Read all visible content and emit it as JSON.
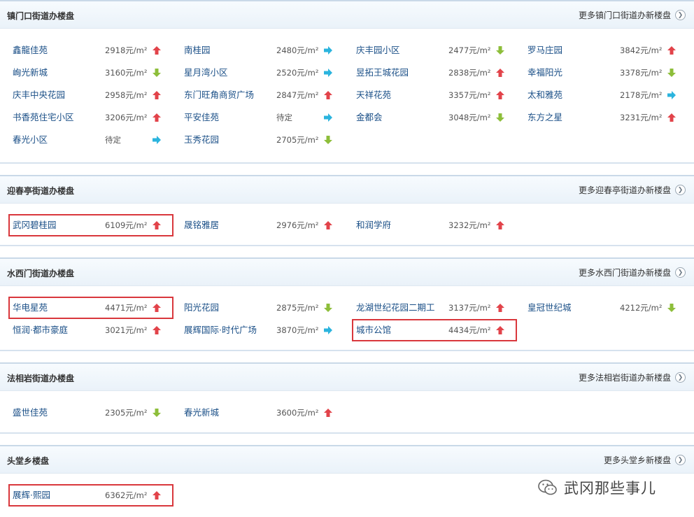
{
  "sections": [
    {
      "title": "镇门口街道办楼盘",
      "more": "更多镇门口街道办新楼盘",
      "items": [
        {
          "name": "鑫龍佳苑",
          "price": "2918元/m²",
          "trend": "up"
        },
        {
          "name": "南桂园",
          "price": "2480元/m²",
          "trend": "flat"
        },
        {
          "name": "庆丰园小区",
          "price": "2477元/m²",
          "trend": "down"
        },
        {
          "name": "罗马庄园",
          "price": "3842元/m²",
          "trend": "up"
        },
        {
          "name": "峋光新城",
          "price": "3160元/m²",
          "trend": "down"
        },
        {
          "name": "星月湾小区",
          "price": "2520元/m²",
          "trend": "flat"
        },
        {
          "name": "昱拓王城花园",
          "price": "2838元/m²",
          "trend": "up"
        },
        {
          "name": "幸福阳光",
          "price": "3378元/m²",
          "trend": "down"
        },
        {
          "name": "庆丰中央花园",
          "price": "2958元/m²",
          "trend": "up"
        },
        {
          "name": "东门旺角商贸广场",
          "price": "2847元/m²",
          "trend": "up"
        },
        {
          "name": "天祥花苑",
          "price": "3357元/m²",
          "trend": "up"
        },
        {
          "name": "太和雅苑",
          "price": "2178元/m²",
          "trend": "flat"
        },
        {
          "name": "书香苑住宅小区",
          "price": "3206元/m²",
          "trend": "up"
        },
        {
          "name": "平安佳苑",
          "price": "待定",
          "trend": "flat"
        },
        {
          "name": "金都会",
          "price": "3048元/m²",
          "trend": "down"
        },
        {
          "name": "东方之星",
          "price": "3231元/m²",
          "trend": "up"
        },
        {
          "name": "春光小区",
          "price": "待定",
          "trend": "flat"
        },
        {
          "name": "玉秀花园",
          "price": "2705元/m²",
          "trend": "down"
        }
      ]
    },
    {
      "title": "迎春亭街道办楼盘",
      "more": "更多迎春亭街道办新楼盘",
      "items": [
        {
          "name": "武冈碧桂园",
          "price": "6109元/m²",
          "trend": "up",
          "highlight": true
        },
        {
          "name": "晟铭雅居",
          "price": "2976元/m²",
          "trend": "up"
        },
        {
          "name": "和润学府",
          "price": "3232元/m²",
          "trend": "up"
        }
      ]
    },
    {
      "title": "水西门街道办楼盘",
      "more": "更多水西门街道办新楼盘",
      "items": [
        {
          "name": "华电星苑",
          "price": "4471元/m²",
          "trend": "up",
          "highlight": true
        },
        {
          "name": "阳光花园",
          "price": "2875元/m²",
          "trend": "down"
        },
        {
          "name": "龙湖世纪花园二期工",
          "price": "3137元/m²",
          "trend": "up"
        },
        {
          "name": "皇冠世纪城",
          "price": "4212元/m²",
          "trend": "down"
        },
        {
          "name": "恒润·都市豪庭",
          "price": "3021元/m²",
          "trend": "up"
        },
        {
          "name": "展辉国际·时代广场",
          "price": "3870元/m²",
          "trend": "flat"
        },
        {
          "name": "城市公馆",
          "price": "4434元/m²",
          "trend": "up",
          "highlight": true
        }
      ]
    },
    {
      "title": "法相岩街道办楼盘",
      "more": "更多法相岩街道办新楼盘",
      "items": [
        {
          "name": "盛世佳苑",
          "price": "2305元/m²",
          "trend": "down"
        },
        {
          "name": "春光新城",
          "price": "3600元/m²",
          "trend": "up"
        }
      ]
    },
    {
      "title": "头堂乡楼盘",
      "more": "更多头堂乡新楼盘",
      "items": [
        {
          "name": "展辉·熙园",
          "price": "6362元/m²",
          "trend": "up",
          "highlight": true
        }
      ]
    }
  ],
  "watermark": "武冈那些事儿",
  "colors": {
    "up": "#e2434a",
    "down": "#8dbe3a",
    "flat": "#2bb4de",
    "link": "#1a4f87",
    "highlight": "#d9373c"
  }
}
